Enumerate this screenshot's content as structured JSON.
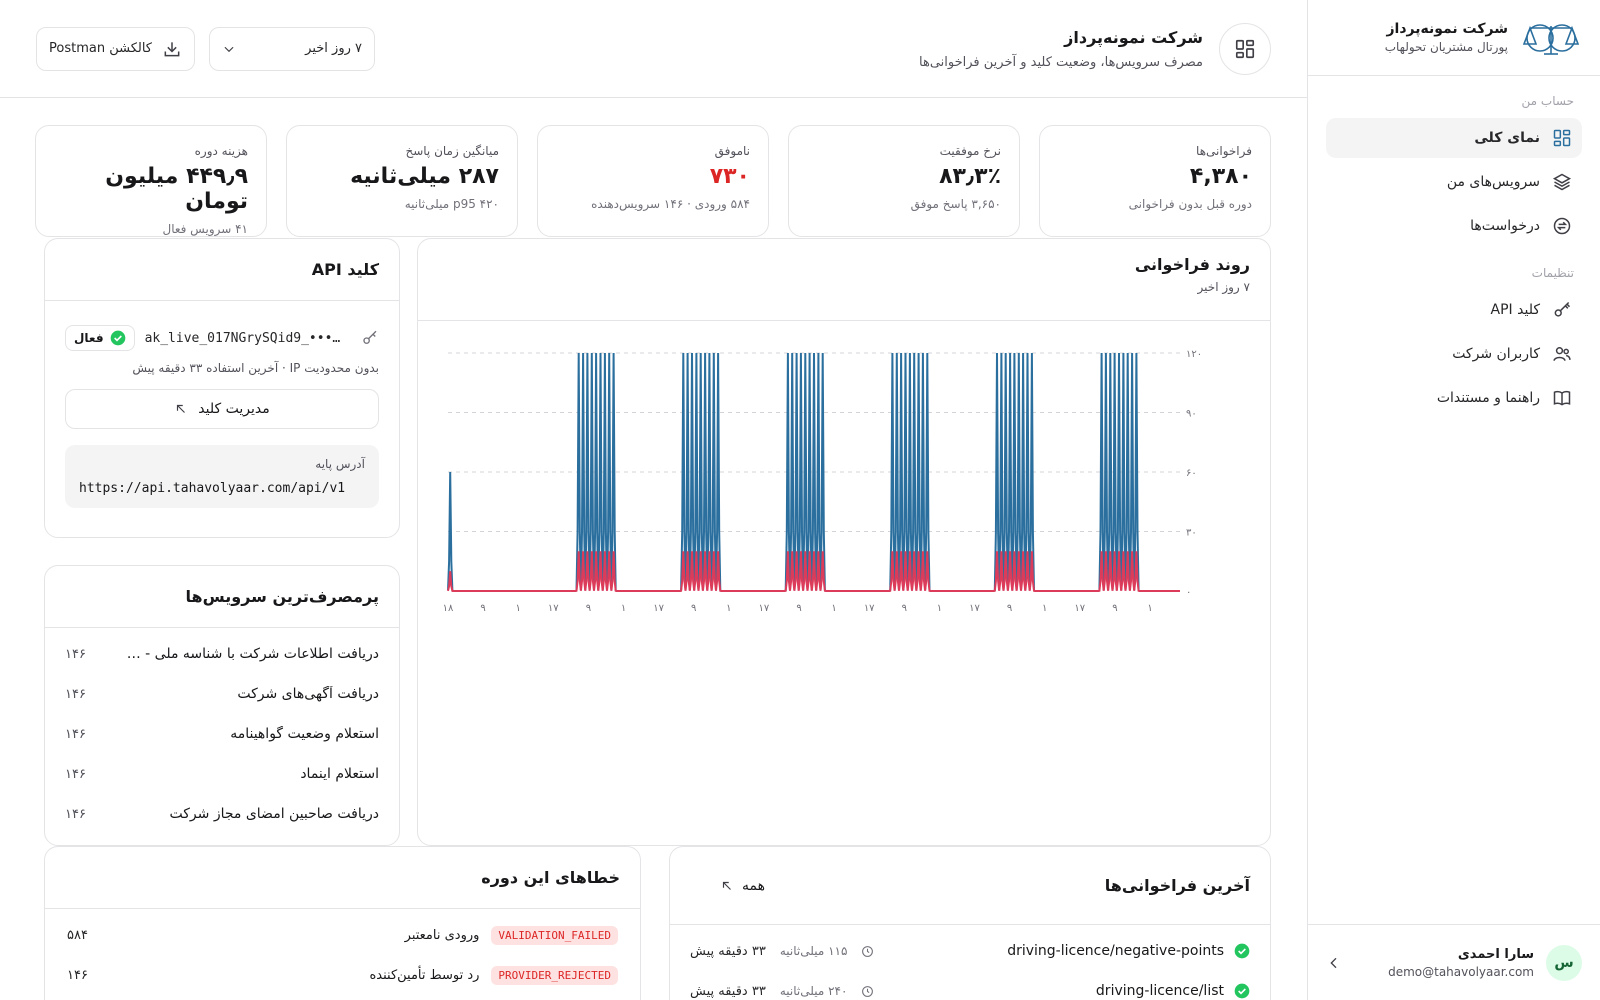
{
  "sidebar": {
    "brand_title": "شرکت نمونه‌پرداز",
    "brand_sub": "پورتال مشتریان تحولهاب",
    "section_account": "حساب من",
    "section_settings": "تنظیمات",
    "items_account": [
      {
        "label": "نمای کلی",
        "icon": "grid-icon",
        "active": true
      },
      {
        "label": "سرویس‌های من",
        "icon": "layers-icon"
      },
      {
        "label": "درخواست‌ها",
        "icon": "exchange-icon"
      }
    ],
    "items_settings": [
      {
        "label": "کلید API",
        "icon": "key-icon"
      },
      {
        "label": "کاربران شرکت",
        "icon": "users-icon"
      },
      {
        "label": "راهنما و مستندات",
        "icon": "book-icon"
      }
    ],
    "user": {
      "initial": "س",
      "name": "سارا احمدی",
      "email": "demo@tahavolyaar.com"
    }
  },
  "header": {
    "title": "شرکت نمونه‌پرداز",
    "subtitle": "مصرف سرویس‌ها، وضعیت کلید و آخرین فراخوانی‌ها",
    "range_select": "۷ روز اخیر",
    "postman_label": "کالکشن Postman"
  },
  "stats": [
    {
      "label": "فراخوانی‌ها",
      "value": "۴,۳۸۰",
      "hint": "دوره قبل بدون فراخوانی"
    },
    {
      "label": "نرخ موفقیت",
      "value": "۸۳٫۳٪",
      "hint": "۳,۶۵۰ پاسخ موفق"
    },
    {
      "label": "ناموفق",
      "value": "۷۳۰",
      "hint": "۵۸۴ ورودی · ۱۴۶ سرویس‌دهنده"
    },
    {
      "label": "میانگین زمان پاسخ",
      "value": "۲۸۷ میلی‌ثانیه",
      "hint": "p95 ۴۲۰ میلی‌ثانیه"
    },
    {
      "label": "هزینه دوره",
      "value": "۴۴۹٫۹ میلیون تومان",
      "hint": "۴۱ سرویس فعال"
    }
  ],
  "api_key": {
    "title": "کلید API",
    "key": "ak_live_017NGrySQid9_•••…",
    "status": "فعال",
    "note": "بدون محدودیت IP · آخرین استفاده ۳۳ دقیقه پیش",
    "manage_label": "مدیریت کلید",
    "base_label": "آدرس پایه",
    "base_url": "https://api.tahavolyaar.com/api/v1"
  },
  "chart_data": {
    "type": "line",
    "title": "روند فراخوانی",
    "subtitle": "۷ روز اخیر",
    "ylim": [
      0,
      120
    ],
    "y_ticks": [
      "۰",
      "۳۰",
      "۶۰",
      "۹۰",
      "۱۲۰"
    ],
    "x_ticks": [
      "۱۸",
      "۹",
      "۱",
      "۱۷",
      "۹",
      "۱",
      "۱۷",
      "۹",
      "۱",
      "۱۷",
      "۹",
      "۱",
      "۱۷",
      "۹",
      "۱",
      "۱۷",
      "۹",
      "۱",
      "۱۷",
      "۹",
      "۱"
    ],
    "grid": true,
    "colors": {
      "total": "#2b6f9e",
      "failed": "#dc3b5a"
    },
    "day_peak_hours": [
      [
        9,
        10,
        11,
        12,
        13,
        14,
        15,
        16,
        17
      ],
      [
        9,
        10,
        11,
        12,
        13,
        14,
        15,
        16,
        17
      ],
      [
        9,
        10,
        11,
        12,
        13,
        14,
        15,
        16,
        17
      ],
      [
        9,
        10,
        11,
        12,
        13,
        14,
        15,
        16,
        17
      ],
      [
        9,
        10,
        11,
        12,
        13,
        14,
        15,
        16,
        17
      ],
      [
        9,
        10,
        11,
        12,
        13,
        14,
        15,
        16,
        17
      ]
    ],
    "series": [
      {
        "values_peak": 120,
        "first_peak": 60
      },
      {
        "values_peak": 20,
        "first_peak": 10
      }
    ]
  },
  "top_services": {
    "title": "پرمصرف‌ترین سرویس‌ها",
    "items": [
      {
        "name": "دریافت اطلاعات شرکت با شناسه ملی - ن...",
        "count": "۱۴۶"
      },
      {
        "name": "دریافت آگهی‌های شرکت",
        "count": "۱۴۶"
      },
      {
        "name": "استعلام وضعیت گواهینامه",
        "count": "۱۴۶"
      },
      {
        "name": "استعلام اینماد",
        "count": "۱۴۶"
      },
      {
        "name": "دریافت صاحبین امضای مجاز شرکت",
        "count": "۱۴۶"
      }
    ]
  },
  "errors": {
    "title": "خطاهای این دوره",
    "items": [
      {
        "code": "VALIDATION_FAILED",
        "label": "ورودی نامعتبر",
        "count": "۵۸۴"
      },
      {
        "code": "PROVIDER_REJECTED",
        "label": "رد توسط تأمین‌کننده",
        "count": "۱۴۶"
      }
    ]
  },
  "recent_calls": {
    "title": "آخرین فراخوانی‌ها",
    "all_label": "همه",
    "items": [
      {
        "path": "driving-licence/negative-points",
        "latency": "۱۱۵ میلی‌ثانیه",
        "ago": "۳۳ دقیقه پیش"
      },
      {
        "path": "driving-licence/list",
        "latency": "۲۴۰ میلی‌ثانیه",
        "ago": "۳۳ دقیقه پیش"
      }
    ]
  }
}
